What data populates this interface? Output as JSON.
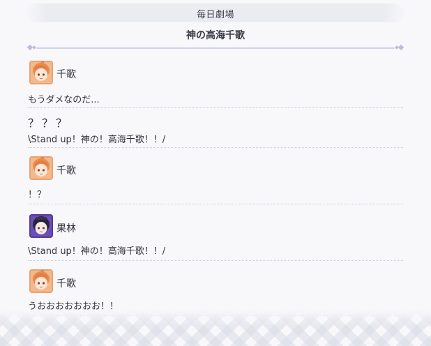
{
  "header": {
    "banner_title": "毎日劇場",
    "subtitle": "神の高海千歌"
  },
  "dialogue": [
    {
      "speaker": "千歌",
      "avatar": "chika-avatar",
      "text": "もうダメなのだ..."
    },
    {
      "speaker": "",
      "marks": "？？？",
      "text": "\\Stand up！神の！高海千歌！！/"
    },
    {
      "speaker": "千歌",
      "avatar": "chika-avatar",
      "text": "！？"
    },
    {
      "speaker": "果林",
      "avatar": "karin-avatar",
      "text": "\\Stand up！神の！高海千歌！！/"
    },
    {
      "speaker": "千歌",
      "avatar": "chika-avatar",
      "text": "うおおおおおおお！！"
    }
  ],
  "colors": {
    "background": "#f8f8fb",
    "banner": "#ebecf2",
    "divider": "#cfd3e2",
    "chika_avatar_bg": "#f3b98c",
    "karin_avatar_bg": "#6a4fb8"
  }
}
